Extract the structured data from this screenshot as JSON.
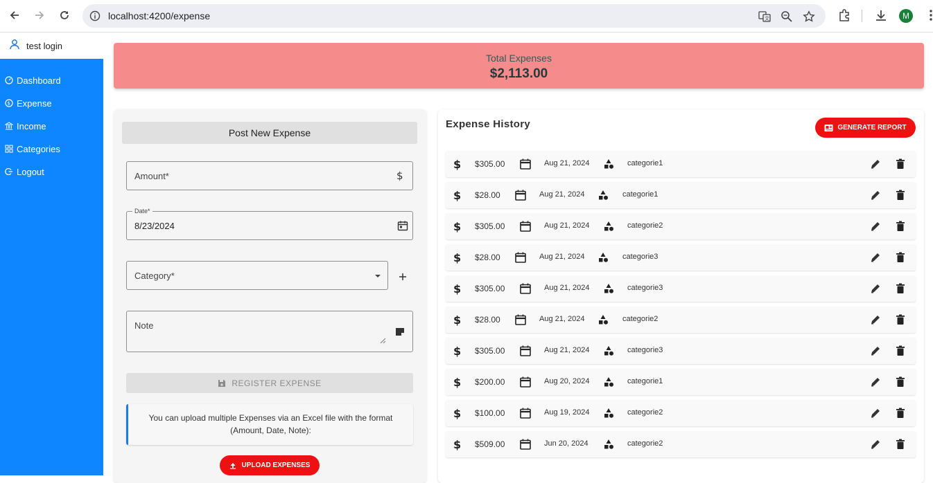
{
  "browser": {
    "url": "localhost:4200/expense",
    "profile_initial": "M"
  },
  "user": {
    "name": "test login"
  },
  "sidebar": {
    "items": [
      {
        "label": "Dashboard",
        "icon": "dashboard-icon"
      },
      {
        "label": "Expense",
        "icon": "dollar-circle-icon"
      },
      {
        "label": "Income",
        "icon": "bank-icon"
      },
      {
        "label": "Categories",
        "icon": "grid-icon"
      },
      {
        "label": "Logout",
        "icon": "logout-icon"
      }
    ]
  },
  "total": {
    "label": "Total Expenses",
    "value": "$2,113.00"
  },
  "form": {
    "title": "Post New Expense",
    "amount_label": "Amount*",
    "date_label": "Date*",
    "date_value": "8/23/2024",
    "category_label": "Category*",
    "note_label": "Note",
    "register_label": "REGISTER EXPENSE",
    "info_text": "You can upload multiple Expenses via an Excel file with the format (Amount, Date, Note):",
    "upload_label": "UPLOAD EXPENSES"
  },
  "history": {
    "title": "Expense History",
    "report_label": "GENERATE REPORT",
    "rows": [
      {
        "amount": "$305.00",
        "date": "Aug 21, 2024",
        "category": "categorie1"
      },
      {
        "amount": "$28.00",
        "date": "Aug 21, 2024",
        "category": "categorie1"
      },
      {
        "amount": "$305.00",
        "date": "Aug 21, 2024",
        "category": "categorie2"
      },
      {
        "amount": "$28.00",
        "date": "Aug 21, 2024",
        "category": "categorie3"
      },
      {
        "amount": "$305.00",
        "date": "Aug 21, 2024",
        "category": "categorie3"
      },
      {
        "amount": "$28.00",
        "date": "Aug 21, 2024",
        "category": "categorie2"
      },
      {
        "amount": "$305.00",
        "date": "Aug 21, 2024",
        "category": "categorie3"
      },
      {
        "amount": "$200.00",
        "date": "Aug 20, 2024",
        "category": "categorie1"
      },
      {
        "amount": "$100.00",
        "date": "Aug 19, 2024",
        "category": "categorie2"
      },
      {
        "amount": "$509.00",
        "date": "Jun 20, 2024",
        "category": "categorie2"
      }
    ]
  },
  "colors": {
    "sidebar": "#0d86ff",
    "total_card": "#f68b8b",
    "accent_button": "#ee1111"
  }
}
